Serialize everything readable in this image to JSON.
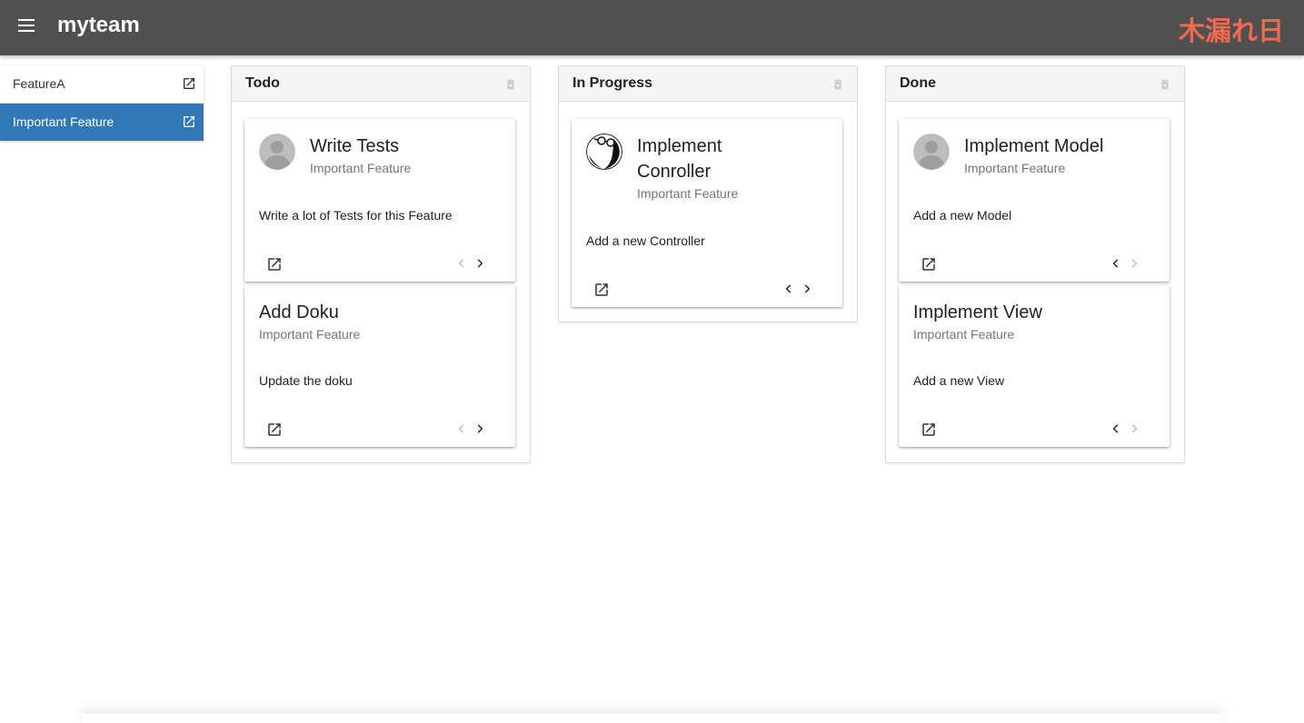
{
  "header": {
    "title": "myteam",
    "brand": "木漏れ日"
  },
  "sidebar": {
    "items": [
      {
        "label": "FeatureA"
      },
      {
        "label": "Important Feature"
      }
    ]
  },
  "columns": [
    {
      "title": "Todo",
      "cards": [
        {
          "title": "Write Tests",
          "subtitle": "Important Feature",
          "description": "Write a lot of Tests for this Feature"
        },
        {
          "title": "Add Doku",
          "subtitle": "Important Feature",
          "description": "Update the doku"
        }
      ]
    },
    {
      "title": "In Progress",
      "cards": [
        {
          "title_line1": "Implement",
          "title_line2": "Conroller",
          "subtitle": "Important Feature",
          "description": "Add a new Controller"
        }
      ]
    },
    {
      "title": "Done",
      "cards": [
        {
          "title": "Implement Model",
          "subtitle": "Important Feature",
          "description": "Add a new Model"
        },
        {
          "title": "Implement View",
          "subtitle": "Important Feature",
          "description": "Add a new View"
        }
      ]
    }
  ],
  "colors": {
    "topbar": "#505050",
    "brand": "#f06a50",
    "active_item": "#3277b8"
  }
}
